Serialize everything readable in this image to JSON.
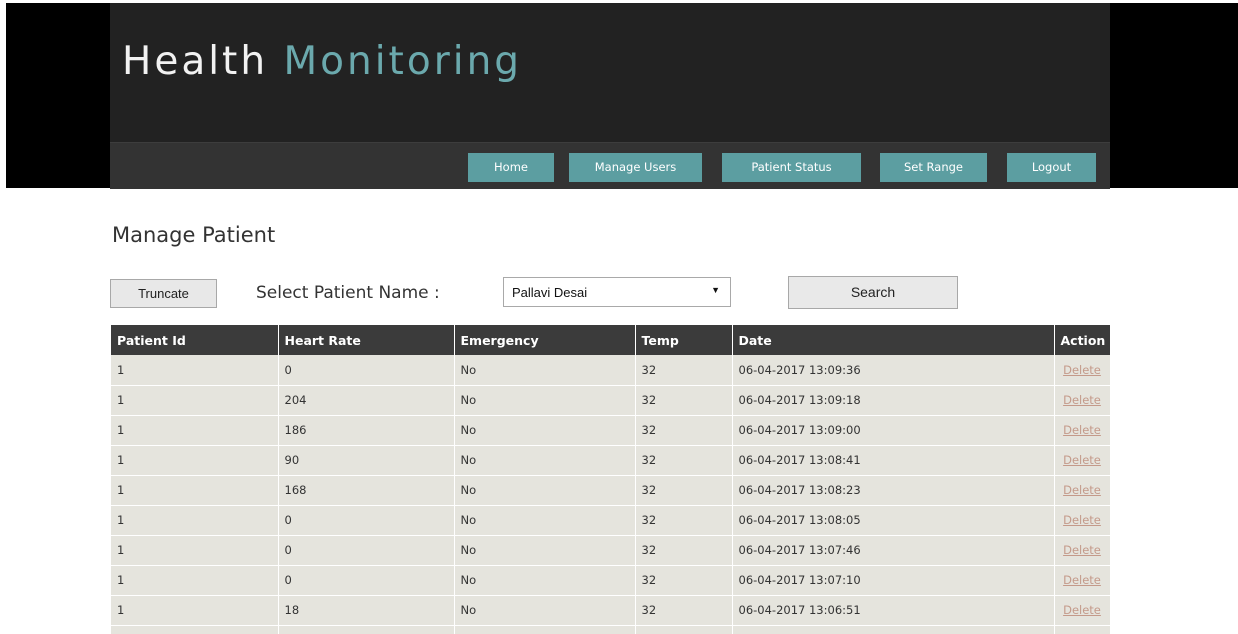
{
  "header": {
    "title_part1": "Health",
    "title_part2": "Monitoring",
    "accent_color": "#6ba9ad"
  },
  "nav": {
    "items": [
      {
        "label": "Home"
      },
      {
        "label": "Manage Users"
      },
      {
        "label": "Patient Status"
      },
      {
        "label": "Set Range"
      },
      {
        "label": "Logout"
      }
    ],
    "button_color": "#5c9ea1"
  },
  "page": {
    "heading": "Manage Patient",
    "truncate_label": "Truncate",
    "select_label": "Select Patient Name :",
    "selected_patient": "Pallavi Desai",
    "search_label": "Search"
  },
  "table": {
    "columns": [
      "Patient Id",
      "Heart Rate",
      "Emergency",
      "Temp",
      "Date",
      "Action"
    ],
    "rows": [
      {
        "patient_id": "1",
        "heart_rate": "0",
        "emergency": "No",
        "temp": "32",
        "date": "06-04-2017 13:09:36",
        "action": "Delete"
      },
      {
        "patient_id": "1",
        "heart_rate": "204",
        "emergency": "No",
        "temp": "32",
        "date": "06-04-2017 13:09:18",
        "action": "Delete"
      },
      {
        "patient_id": "1",
        "heart_rate": "186",
        "emergency": "No",
        "temp": "32",
        "date": "06-04-2017 13:09:00",
        "action": "Delete"
      },
      {
        "patient_id": "1",
        "heart_rate": "90",
        "emergency": "No",
        "temp": "32",
        "date": "06-04-2017 13:08:41",
        "action": "Delete"
      },
      {
        "patient_id": "1",
        "heart_rate": "168",
        "emergency": "No",
        "temp": "32",
        "date": "06-04-2017 13:08:23",
        "action": "Delete"
      },
      {
        "patient_id": "1",
        "heart_rate": "0",
        "emergency": "No",
        "temp": "32",
        "date": "06-04-2017 13:08:05",
        "action": "Delete"
      },
      {
        "patient_id": "1",
        "heart_rate": "0",
        "emergency": "No",
        "temp": "32",
        "date": "06-04-2017 13:07:46",
        "action": "Delete"
      },
      {
        "patient_id": "1",
        "heart_rate": "0",
        "emergency": "No",
        "temp": "32",
        "date": "06-04-2017 13:07:10",
        "action": "Delete"
      },
      {
        "patient_id": "1",
        "heart_rate": "18",
        "emergency": "No",
        "temp": "32",
        "date": "06-04-2017 13:06:51",
        "action": "Delete"
      }
    ]
  }
}
